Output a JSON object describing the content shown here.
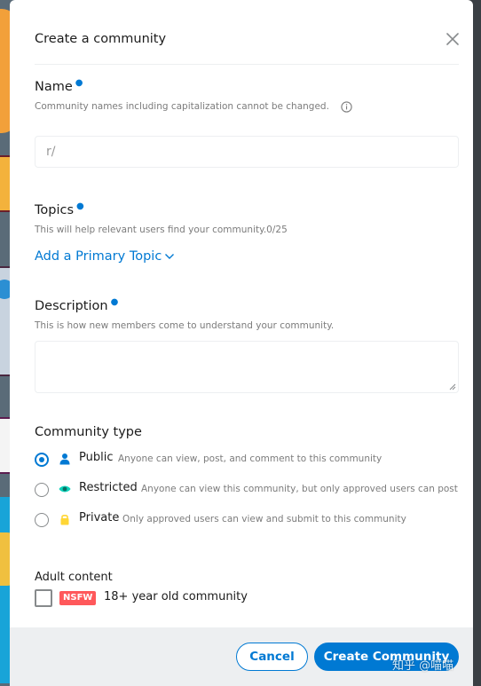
{
  "modal": {
    "title": "Create a community"
  },
  "name_section": {
    "label": "Name",
    "hint": "Community names including capitalization cannot be changed.",
    "prefix": "r/",
    "value": ""
  },
  "topics_section": {
    "label": "Topics",
    "hint": "This will help relevant users find your community.0/25",
    "add_topic_label": "Add a Primary Topic"
  },
  "description_section": {
    "label": "Description",
    "hint": "This is how new members come to understand your community.",
    "value": ""
  },
  "community_type": {
    "label": "Community type",
    "selected": "public",
    "options": [
      {
        "id": "public",
        "name": "Public",
        "description": "Anyone can view, post, and comment to this community",
        "icon": "user-icon"
      },
      {
        "id": "restricted",
        "name": "Restricted",
        "description": "Anyone can view this community, but only approved users can post",
        "icon": "eye-icon"
      },
      {
        "id": "private",
        "name": "Private",
        "description": "Only approved users can view and submit to this community",
        "icon": "lock-icon"
      }
    ]
  },
  "adult_content": {
    "label": "Adult content",
    "badge": "NSFW",
    "checkbox_label": "18+ year old community",
    "checked": false
  },
  "footer": {
    "cancel_label": "Cancel",
    "create_label": "Create Community"
  },
  "watermark": "知乎 @喵喵",
  "colors": {
    "accent": "#0079d3",
    "nsfw": "#ff585b",
    "footer_bg": "#edeff1"
  }
}
